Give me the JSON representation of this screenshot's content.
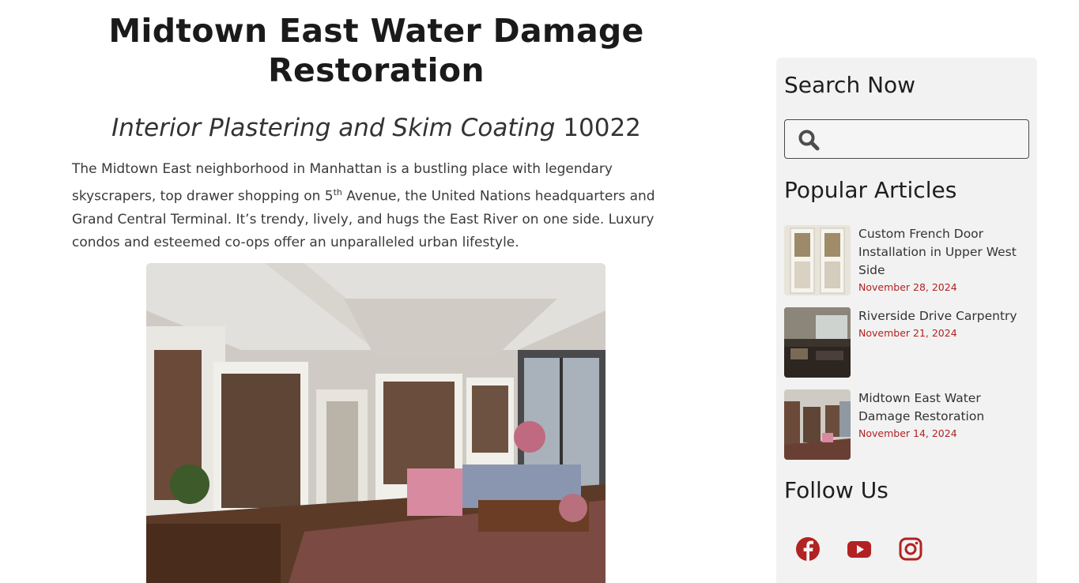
{
  "main": {
    "title": "Midtown East Water Damage Restoration",
    "subtitle_italic": "Interior Plastering and Skim Coating",
    "subtitle_zip": "10022",
    "intro_part1": "The Midtown East neighborhood in Manhattan is a bustling place with legendary skyscrapers, top drawer shopping on 5",
    "intro_sup": "th",
    "intro_part2": " Avenue, the United Nations headquarters and Grand Central Terminal. It’s trendy, lively, and hugs the East River on one side. Luxury condos and esteemed co-ops offer an unparalleled urban lifestyle."
  },
  "sidebar": {
    "search_heading": "Search Now",
    "search_value": "",
    "popular_heading": "Popular Articles",
    "articles": [
      {
        "title": "Custom French Door Installation in Upper West Side",
        "date": "November 28, 2024"
      },
      {
        "title": "Riverside Drive Carpentry",
        "date": "November 21, 2024"
      },
      {
        "title": "Midtown East Water Damage Restoration",
        "date": "November 14, 2024"
      }
    ],
    "follow_heading": "Follow Us",
    "social": [
      "facebook-icon",
      "youtube-icon",
      "instagram-icon"
    ]
  },
  "colors": {
    "accent_red": "#b22222",
    "sidebar_bg": "#f2f2f2",
    "text_dark": "#1a1a1a"
  }
}
